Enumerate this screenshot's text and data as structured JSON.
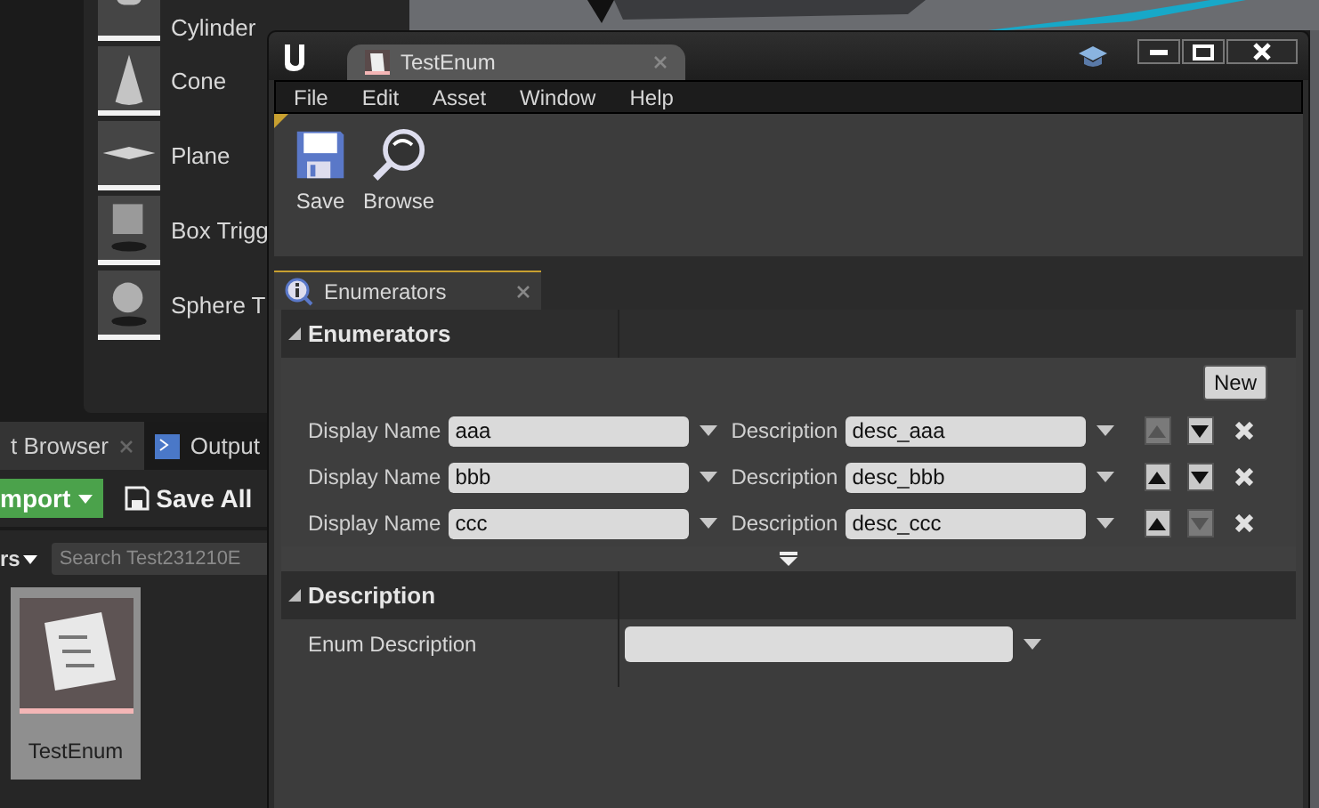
{
  "place_panel": {
    "items": [
      {
        "label": "Cylinder",
        "kind": "cylinder"
      },
      {
        "label": "Cone",
        "kind": "cone"
      },
      {
        "label": "Plane",
        "kind": "plane"
      },
      {
        "label": "Box Trigg",
        "kind": "box"
      },
      {
        "label": "Sphere T",
        "kind": "sphere"
      }
    ]
  },
  "content_browser": {
    "tabs": [
      {
        "label": "t Browser",
        "selected": true
      },
      {
        "label": "Output",
        "selected": false
      }
    ],
    "import_button": "mport",
    "save_all_button": "Save All",
    "filter_button": "rs",
    "search": {
      "placeholder": "Search Test231210E"
    },
    "assets": [
      {
        "label": "TestEnum",
        "selected": true
      }
    ]
  },
  "editor_window": {
    "tab": {
      "title": "TestEnum"
    },
    "menu": [
      "File",
      "Edit",
      "Asset",
      "Window",
      "Help"
    ],
    "toolbar": [
      {
        "label": "Save",
        "kind": "save"
      },
      {
        "label": "Browse",
        "kind": "browse"
      }
    ],
    "panel_tab": {
      "label": "Enumerators"
    },
    "enumerators_section": {
      "title": "Enumerators",
      "new_button": "New",
      "rows": [
        {
          "display_label": "Display Name",
          "display_name": "aaa",
          "description_label": "Description",
          "description": "desc_aaa",
          "up_enabled": false,
          "down_enabled": true
        },
        {
          "display_label": "Display Name",
          "display_name": "bbb",
          "description_label": "Description",
          "description": "desc_bbb",
          "up_enabled": true,
          "down_enabled": true
        },
        {
          "display_label": "Display Name",
          "display_name": "ccc",
          "description_label": "Description",
          "description": "desc_ccc",
          "up_enabled": true,
          "down_enabled": false
        }
      ]
    },
    "description_section": {
      "title": "Description",
      "property_label": "Enum Description"
    }
  }
}
